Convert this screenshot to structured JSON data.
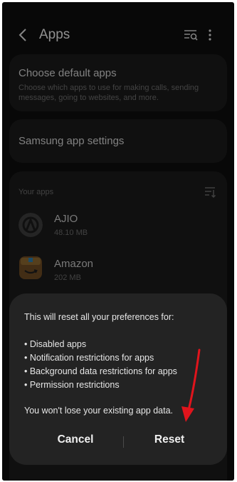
{
  "header": {
    "title": "Apps",
    "back_icon": "back-arrow-icon",
    "search_icon": "search-list-icon",
    "more_icon": "more-vertical-icon"
  },
  "default_apps": {
    "title": "Choose default apps",
    "subtitle_line1": "Choose which apps to use for making calls, sending",
    "subtitle_line2": "messages, going to websites, and more."
  },
  "samsung_settings": {
    "title": "Samsung app settings"
  },
  "your_apps": {
    "label": "Your apps",
    "items": [
      {
        "name": "AJIO",
        "size": "48.10 MB"
      },
      {
        "name": "Amazon",
        "size": "202 MB"
      }
    ]
  },
  "dialog": {
    "intro": "This will reset all your preferences for:",
    "bullets": [
      "• Disabled apps",
      "• Notification restrictions for apps",
      "• Background data restrictions for apps",
      "• Permission restrictions"
    ],
    "note": "You won't lose your existing app data.",
    "cancel_label": "Cancel",
    "reset_label": "Reset"
  },
  "colors": {
    "background": "#0d0d0d",
    "card": "#1b1b1b",
    "dialog": "#232323",
    "annotation_arrow": "#e0141c"
  }
}
